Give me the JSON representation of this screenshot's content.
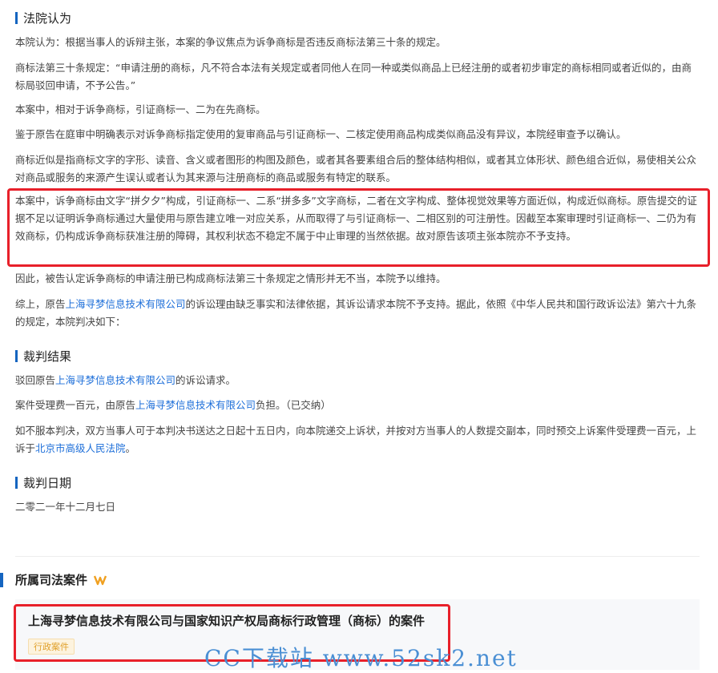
{
  "court_opinion": {
    "heading": "法院认为",
    "p1": "本院认为：根据当事人的诉辩主张，本案的争议焦点为诉争商标是否违反商标法第三十条的规定。",
    "p2": "商标法第三十条规定：“申请注册的商标，凡不符合本法有关规定或者同他人在同一种或类似商品上已经注册的或者初步审定的商标相同或者近似的，由商标局驳回申请，不予公告。”",
    "p3": "本案中，相对于诉争商标，引证商标一、二为在先商标。",
    "p4": "鉴于原告在庭审中明确表示对诉争商标指定使用的复审商品与引证商标一、二核定使用商品构成类似商品没有异议，本院经审查予以确认。",
    "p5": "商标近似是指商标文字的字形、读音、含义或者图形的构图及颜色，或者其各要素组合后的整体结构相似，或者其立体形状、颜色组合近似，易使相关公众对商品或服务的来源产生误认或者认为其来源与注册商标的商品或服务有特定的联系。",
    "p6": "本案中，诉争商标由文字“拼夕夕”构成，引证商标一、二系“拼多多”文字商标，二者在文字构成、整体视觉效果等方面近似，构成近似商标。原告提交的证据不足以证明诉争商标通过大量使用与原告建立唯一对应关系，从而取得了与引证商标一、二相区别的可注册性。因截至本案审理时引证商标一、二仍为有效商标，仍构成诉争商标获准注册的障碍，其权利状态不稳定不属于中止审理的当然依据。故对原告该项主张本院亦不予支持。",
    "p7": "因此，被告认定诉争商标的申请注册已构成商标法第三十条规定之情形并无不当，本院予以维持。",
    "p8_pre": "综上，原告",
    "p8_link": "上海寻梦信息技术有限公司",
    "p8_post": "的诉讼理由缺乏事实和法律依据，其诉讼请求本院不予支持。据此，依照《中华人民共和国行政诉讼法》第六十九条的规定，本院判决如下："
  },
  "judgment": {
    "heading": "裁判结果",
    "r1_pre": "驳回原告",
    "r1_link": "上海寻梦信息技术有限公司",
    "r1_post": "的诉讼请求。",
    "r2_pre": "案件受理费一百元，由原告",
    "r2_link": "上海寻梦信息技术有限公司",
    "r2_post": "负担。（已交纳）",
    "r3_pre": "如不服本判决，双方当事人可于本判决书送达之日起十五日内，向本院递交上诉状，并按对方当事人的人数提交副本，同时预交上诉案件受理费一百元，上诉于",
    "r3_link": "北京市高级人民法院",
    "r3_post": "。"
  },
  "judgment_date": {
    "heading": "裁判日期",
    "value": "二零二一年十二月七日"
  },
  "related_cases": {
    "heading": "所属司法案件",
    "case_title": "上海寻梦信息技术有限公司与国家知识产权局商标行政管理（商标）的案件",
    "case_tag": "行政案件"
  },
  "watermark": "CC下载站 www.52sk2.net",
  "colors": {
    "accent_bar": "#1565c0",
    "link": "#1e6fd9",
    "highlight_border": "#e8202a",
    "tag_text": "#e0a02a"
  },
  "icons": {
    "vip": "vip-badge-icon"
  }
}
